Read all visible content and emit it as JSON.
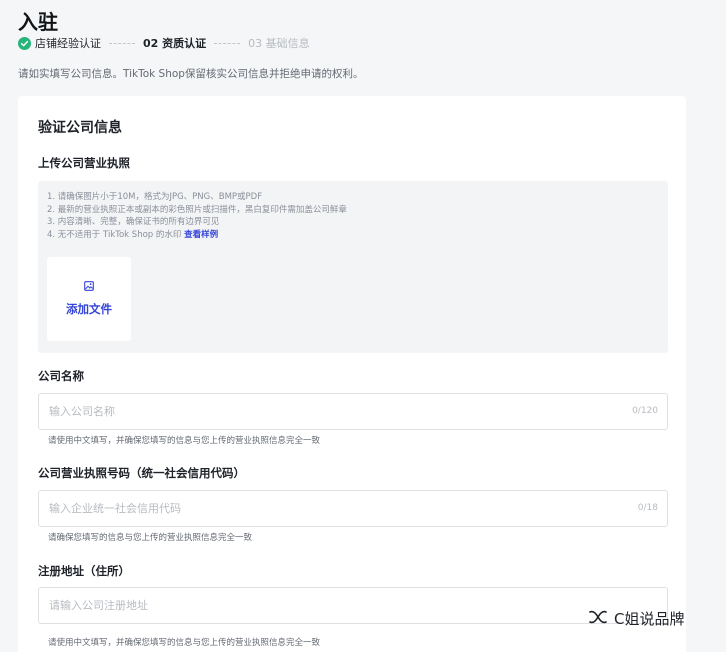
{
  "page": {
    "title": "入驻"
  },
  "steps": [
    {
      "label": "店铺经验认证",
      "state": "done"
    },
    {
      "label": "02 资质认证",
      "state": "active"
    },
    {
      "label": "03 基础信息",
      "state": "pending"
    }
  ],
  "intro": "请如实填写公司信息。TikTok Shop保留核实公司信息并拒绝申请的权利。",
  "card": {
    "title": "验证公司信息",
    "license": {
      "label": "上传公司营业执照",
      "tips": [
        "1. 请确保图片小于10M，格式为JPG、PNG、BMP或PDF",
        "2. 最新的营业执照正本或副本的彩色照片或扫描件，黑白复印件需加盖公司鲜章",
        "3. 内容清晰、完整，确保证书的所有边界可见",
        "4. 无不适用于 TikTok Shop 的水印 "
      ],
      "tips_link": "查看样例",
      "add_file": "添加文件"
    },
    "company_name": {
      "label": "公司名称",
      "placeholder": "输入公司名称",
      "counter": "0/120",
      "hint": "请使用中文填写，并确保您填写的信息与您上传的营业执照信息完全一致"
    },
    "license_number": {
      "label": "公司营业执照号码（统一社会信用代码）",
      "placeholder": "输入企业统一社会信用代码",
      "counter": "0/18",
      "hint": "请确保您填写的信息与您上传的营业执照信息完全一致"
    },
    "address": {
      "label": "注册地址（住所）",
      "placeholder": "请输入公司注册地址",
      "hint": "请使用中文填写，并确保您填写的信息与您上传的营业执照信息完全一致"
    }
  },
  "watermark": {
    "text": "C姐说品牌",
    "icon": "wechat-channel-icon"
  },
  "colors": {
    "accent": "#3444d6",
    "success": "#27b57a",
    "background": "#f5f6f7"
  }
}
